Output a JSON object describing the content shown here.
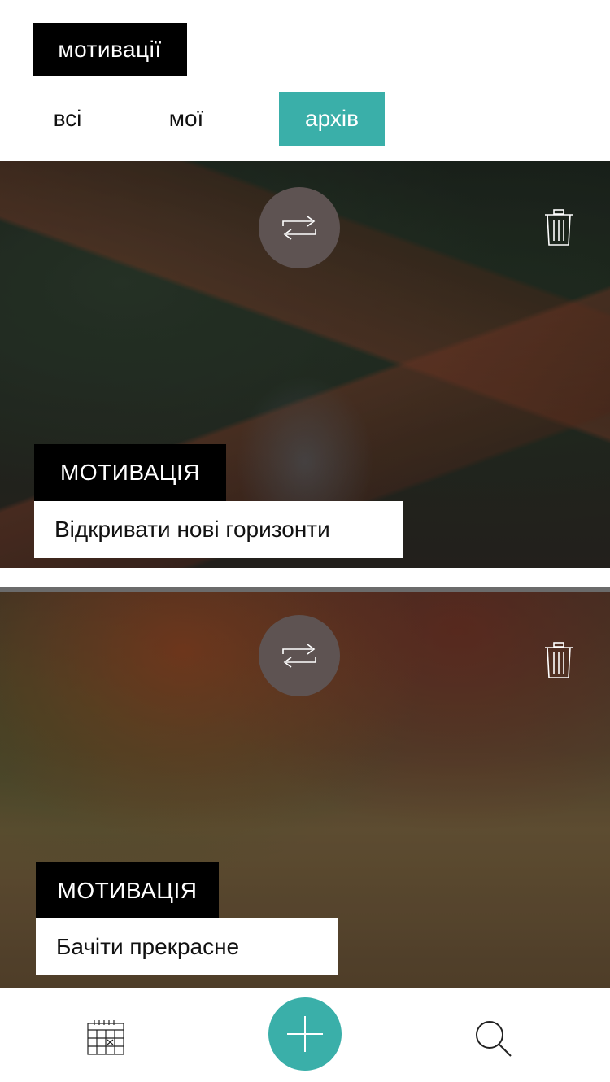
{
  "header": {
    "title": "мотивації"
  },
  "tabs": [
    {
      "label": "всі",
      "active": false
    },
    {
      "label": "мої",
      "active": false
    },
    {
      "label": "архів",
      "active": true
    }
  ],
  "cards": [
    {
      "category": "МОТИВАЦІЯ",
      "text": "Відкривати нові горизонти",
      "actions": [
        "repeat-icon",
        "trash-icon"
      ]
    },
    {
      "category": "МОТИВАЦІЯ",
      "text": "Бачіти прекрасне",
      "actions": [
        "repeat-icon",
        "trash-icon"
      ]
    }
  ],
  "bottom_nav": {
    "items": [
      "calendar-icon",
      "plus-icon",
      "search-icon"
    ]
  },
  "colors": {
    "accent": "#3aafa9",
    "repeat_button": "#5e5352",
    "label_bg": "#000000"
  }
}
